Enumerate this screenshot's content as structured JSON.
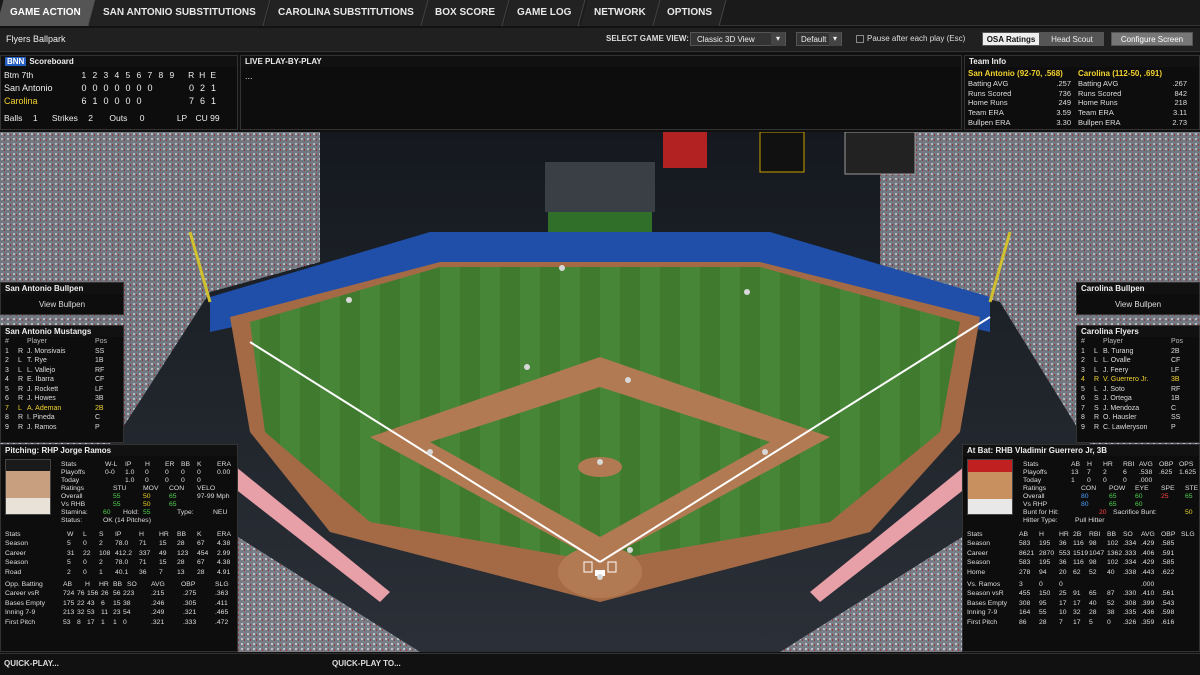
{
  "tabs": [
    {
      "label": "GAME ACTION",
      "active": true
    },
    {
      "label": "SAN ANTONIO SUBSTITUTIONS",
      "active": false
    },
    {
      "label": "CAROLINA SUBSTITUTIONS",
      "active": false
    },
    {
      "label": "BOX SCORE",
      "active": false
    },
    {
      "label": "GAME LOG",
      "active": false
    },
    {
      "label": "NETWORK",
      "active": false
    },
    {
      "label": "OPTIONS",
      "active": false
    }
  ],
  "toolbar": {
    "ballpark": "Flyers Ballpark",
    "select_view_label": "SELECT GAME VIEW:",
    "view_value": "Classic 3D View",
    "camera_value": "Default",
    "pause_label": "Pause after each play (Esc)",
    "osa_label": "OSA Ratings",
    "scout_label": "Head Scout",
    "configure_label": "Configure Screen"
  },
  "scoreboard": {
    "network_logo": "BNN",
    "title": "Scoreboard",
    "inning": "Btm 7th",
    "innings": [
      "1",
      "2",
      "3",
      "4",
      "5",
      "6",
      "7",
      "8",
      "9"
    ],
    "rhe": [
      "R",
      "H",
      "E"
    ],
    "away": {
      "name": "San Antonio",
      "line": [
        "0",
        "0",
        "0",
        "0",
        "0",
        "0",
        "0",
        "",
        ""
      ],
      "r": "0",
      "h": "2",
      "e": "1"
    },
    "home": {
      "name": "Carolina",
      "line": [
        "6",
        "1",
        "0",
        "0",
        "0",
        "0",
        "",
        "",
        ""
      ],
      "r": "7",
      "h": "6",
      "e": "1"
    },
    "balls_label": "Balls",
    "balls": "1",
    "strikes_label": "Strikes",
    "strikes": "2",
    "outs_label": "Outs",
    "outs": "0",
    "lp_label": "LP",
    "pitch": "CU 99"
  },
  "pbp": {
    "title": "LIVE PLAY-BY-PLAY",
    "text": "..."
  },
  "team_info": {
    "title": "Team Info",
    "away_header": "San Antonio (92-70, .568)",
    "home_header": "Carolina (112-50, .691)",
    "rows": [
      {
        "label": "Batting AVG",
        "away": ".257",
        "home": ".267"
      },
      {
        "label": "Runs Scored",
        "away": "736",
        "home": "842"
      },
      {
        "label": "Home Runs",
        "away": "249",
        "home": "218"
      },
      {
        "label": "Team ERA",
        "away": "3.59",
        "home": "3.11"
      },
      {
        "label": "Bullpen ERA",
        "away": "3.30",
        "home": "2.73"
      }
    ]
  },
  "bullpen_left": {
    "title": "San Antonio Bullpen",
    "button": "View Bullpen"
  },
  "bullpen_right": {
    "title": "Carolina Bullpen",
    "button": "View Bullpen"
  },
  "lineup_left": {
    "title": "San Antonio Mustangs",
    "head": {
      "num": "#",
      "player": "Player",
      "pos": "Pos"
    },
    "players": [
      {
        "n": "1",
        "b": "R",
        "name": "J. Monsivais",
        "pos": "SS"
      },
      {
        "n": "2",
        "b": "L",
        "name": "T. Rye",
        "pos": "1B"
      },
      {
        "n": "3",
        "b": "L",
        "name": "L. Vallejo",
        "pos": "RF"
      },
      {
        "n": "4",
        "b": "R",
        "name": "E. Ibarra",
        "pos": "CF"
      },
      {
        "n": "5",
        "b": "R",
        "name": "J. Rockett",
        "pos": "LF"
      },
      {
        "n": "6",
        "b": "R",
        "name": "J. Howes",
        "pos": "3B"
      },
      {
        "n": "7",
        "b": "L",
        "name": "A. Ademan",
        "pos": "2B"
      },
      {
        "n": "8",
        "b": "R",
        "name": "I. Pineda",
        "pos": "C"
      },
      {
        "n": "9",
        "b": "R",
        "name": "J. Ramos",
        "pos": "P"
      }
    ]
  },
  "lineup_right": {
    "title": "Carolina Flyers",
    "head": {
      "num": "#",
      "player": "Player",
      "pos": "Pos"
    },
    "players": [
      {
        "n": "1",
        "b": "L",
        "name": "B. Turang",
        "pos": "2B"
      },
      {
        "n": "2",
        "b": "L",
        "name": "L. Ovalle",
        "pos": "CF"
      },
      {
        "n": "3",
        "b": "L",
        "name": "J. Feery",
        "pos": "LF"
      },
      {
        "n": "4",
        "b": "R",
        "name": "V. Guerrero Jr.",
        "pos": "3B"
      },
      {
        "n": "5",
        "b": "L",
        "name": "J. Soto",
        "pos": "RF"
      },
      {
        "n": "6",
        "b": "S",
        "name": "J. Ortega",
        "pos": "1B"
      },
      {
        "n": "7",
        "b": "S",
        "name": "J. Mendoza",
        "pos": "C"
      },
      {
        "n": "8",
        "b": "R",
        "name": "O. Hausler",
        "pos": "SS"
      },
      {
        "n": "9",
        "b": "R",
        "name": "C. Lawleryson",
        "pos": "P"
      }
    ]
  },
  "pitcher": {
    "title": "Pitching: RHP Jorge Ramos",
    "stat_head": [
      "Stats",
      "W-L",
      "IP",
      "H",
      "ER",
      "BB",
      "K",
      "ERA"
    ],
    "stat_rows": [
      [
        "Playoffs",
        "0-0",
        "1.0",
        "0",
        "0",
        "0",
        "0",
        "0.00"
      ],
      [
        "Today",
        "",
        "1.0",
        "0",
        "0",
        "0",
        "0",
        ""
      ]
    ],
    "rat_head": [
      "Ratings",
      "STU",
      "MOV",
      "CON",
      "VELO"
    ],
    "rat_rows": [
      [
        "Overall",
        "55",
        "50",
        "65",
        "97-99 Mph"
      ],
      [
        "Vs RHB",
        "55",
        "50",
        "65",
        ""
      ]
    ],
    "stamina_label": "Stamina:",
    "stamina": "60",
    "hold_label": "Hold:",
    "hold": "55",
    "type_label": "Type:",
    "type": "NEU",
    "status_label": "Status:",
    "status": "OK (14 Pitches)",
    "season_head": [
      "Stats",
      "W",
      "L",
      "S",
      "IP",
      "H",
      "HR",
      "BB",
      "K",
      "ERA"
    ],
    "season_rows": [
      [
        "Season",
        "5",
        "0",
        "2",
        "78.0",
        "71",
        "15",
        "28",
        "67",
        "4.38"
      ],
      [
        "Career",
        "31",
        "22",
        "108",
        "412.2",
        "337",
        "49",
        "123",
        "454",
        "2.99"
      ],
      [
        "Season",
        "5",
        "0",
        "2",
        "78.0",
        "71",
        "15",
        "28",
        "67",
        "4.38"
      ],
      [
        "Road",
        "2",
        "0",
        "1",
        "40.1",
        "36",
        "7",
        "13",
        "28",
        "4.91"
      ]
    ],
    "opp_head": [
      "Opp. Batting",
      "AB",
      "H",
      "HR",
      "BB",
      "SO",
      "AVG",
      "OBP",
      "SLG"
    ],
    "opp_rows": [
      [
        "Career vsR",
        "724",
        "76",
        "156",
        "26",
        "56",
        "223",
        ".215",
        ".275",
        ".363"
      ],
      [
        "Bases Empty",
        "175",
        "22",
        "43",
        "6",
        "15",
        "38",
        ".246",
        ".305",
        ".411"
      ],
      [
        "Inning 7-9",
        "213",
        "32",
        "53",
        "11",
        "23",
        "54",
        ".249",
        ".321",
        ".465"
      ],
      [
        "First Pitch",
        "53",
        "8",
        "17",
        "1",
        "1",
        "0",
        ".321",
        ".333",
        ".472"
      ]
    ]
  },
  "batter": {
    "title": "At Bat: RHB Vladimir Guerrero Jr, 3B",
    "stat_head": [
      "Stats",
      "AB",
      "H",
      "HR",
      "RBI",
      "AVG",
      "OBP",
      "OPS"
    ],
    "stat_rows": [
      [
        "Playoffs",
        "13",
        "7",
        "2",
        "6",
        ".538",
        ".625",
        "1.625"
      ],
      [
        "Today",
        "1",
        "0",
        "0",
        "0",
        ".000",
        "",
        ""
      ]
    ],
    "rat_head": [
      "Ratings",
      "CON",
      "POW",
      "EYE",
      "SPE",
      "STE"
    ],
    "rat_rows": [
      [
        "Overall",
        "80",
        "65",
        "60",
        "25",
        "65"
      ],
      [
        "Vs RHP",
        "80",
        "65",
        "60",
        "",
        ""
      ]
    ],
    "bunt_label": "Bunt for Hit:",
    "bunt": "20",
    "sac_label": "Sacrifice Bunt:",
    "sac": "50",
    "hitter_label": "Hitter Type:",
    "hitter": "Pull Hitter",
    "season_head": [
      "Stats",
      "AB",
      "H",
      "HR",
      "2B",
      "RBI",
      "BB",
      "SO",
      "AVG",
      "OBP",
      "SLG"
    ],
    "season_rows": [
      [
        "Season",
        "583",
        "195",
        "36",
        "116",
        "98",
        "102",
        ".334",
        ".429",
        ".585"
      ],
      [
        "Career",
        "8621",
        "2870",
        "553",
        "1519",
        "1047",
        "1362",
        ".333",
        ".406",
        ".591"
      ],
      [
        "Season",
        "583",
        "195",
        "36",
        "116",
        "98",
        "102",
        ".334",
        ".429",
        ".585"
      ],
      [
        "Home",
        "278",
        "94",
        "20",
        "62",
        "52",
        "40",
        ".338",
        ".443",
        ".622"
      ]
    ],
    "vs_head": [
      "Vs. Ramos",
      "3",
      "0",
      "0",
      "",
      "",
      "",
      "",
      ".000",
      "",
      ""
    ],
    "split_rows": [
      [
        "Season vsR",
        "455",
        "150",
        "25",
        "91",
        "65",
        "87",
        ".330",
        ".410",
        ".561"
      ],
      [
        "Bases Empty",
        "308",
        "95",
        "17",
        "17",
        "40",
        "52",
        ".308",
        ".399",
        ".543"
      ],
      [
        "Inning 7-9",
        "164",
        "55",
        "10",
        "32",
        "28",
        "38",
        ".335",
        ".436",
        ".598"
      ],
      [
        "First Pitch",
        "86",
        "28",
        "7",
        "17",
        "5",
        "0",
        ".326",
        ".359",
        ".616"
      ]
    ]
  },
  "bottom": {
    "quickplay": "QUICK-PLAY...",
    "quickplay_to": "QUICK-PLAY TO..."
  },
  "colors": {
    "accent": "#f2d330",
    "green": "#4fd04f",
    "blue": "#4aa0ff",
    "red": "#ff4040"
  }
}
